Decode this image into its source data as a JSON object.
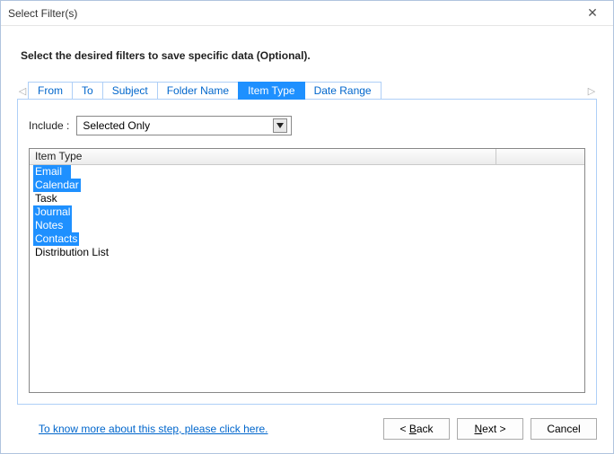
{
  "window": {
    "title": "Select Filter(s)",
    "close_label": "✕"
  },
  "instruction": "Select the desired filters to save specific data (Optional).",
  "tabs": [
    {
      "label": "From",
      "active": false
    },
    {
      "label": "To",
      "active": false
    },
    {
      "label": "Subject",
      "active": false
    },
    {
      "label": "Folder Name",
      "active": false
    },
    {
      "label": "Item Type",
      "active": true
    },
    {
      "label": "Date Range",
      "active": false
    }
  ],
  "include": {
    "label": "Include :",
    "value": "Selected Only"
  },
  "list": {
    "header": "Item Type",
    "items": [
      {
        "label": "Email",
        "selected": true,
        "wide": true
      },
      {
        "label": "Calendar",
        "selected": true
      },
      {
        "label": "Task",
        "selected": false
      },
      {
        "label": "Journal",
        "selected": true
      },
      {
        "label": "Notes",
        "selected": true,
        "wide": true
      },
      {
        "label": "Contacts",
        "selected": true
      },
      {
        "label": "Distribution List",
        "selected": false
      }
    ]
  },
  "help_link": "To know more about this step, please click here.",
  "buttons": {
    "back_prefix": "< ",
    "back_u": "B",
    "back_rest": "ack",
    "next_u": "N",
    "next_rest": "ext >",
    "cancel": "Cancel"
  }
}
